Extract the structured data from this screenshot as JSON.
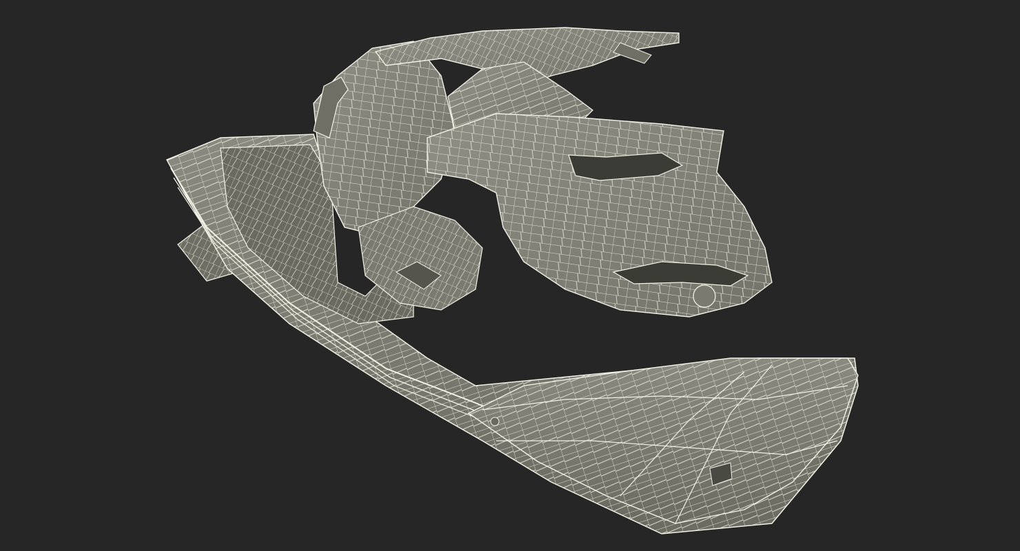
{
  "viewport": {
    "background": "#262626",
    "object": "jet-ski",
    "render_mode": "wireframe-on-shaded"
  },
  "colors": {
    "surface": "#7f7f75",
    "surface_light": "#8c8c81",
    "surface_dark": "#5f5f57",
    "shadow": "#4a4a44",
    "wire": "#f2f2e6"
  }
}
